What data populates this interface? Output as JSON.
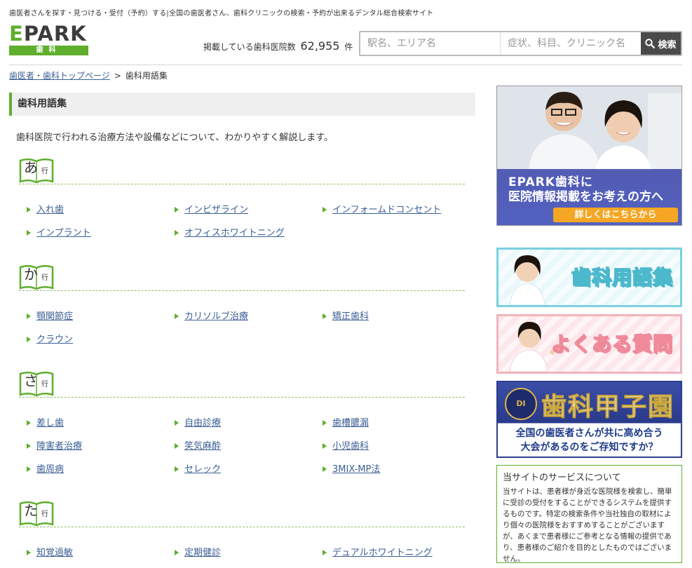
{
  "header": {
    "tagline": "歯医者さんを探す・見つける・受付（予約）する|全国の歯医者さん、歯科クリニックの検索・予約が出来るデンタル総合検索サイト",
    "logo_text": "PARK",
    "logo_letter": "E",
    "logo_sub": "歯科",
    "count_prefix": "掲載している歯科医院数",
    "count_value": "62,955",
    "count_suffix": "件",
    "search_station_placeholder": "駅名、エリア名",
    "search_keyword_placeholder": "症状、科目、クリニック名",
    "search_button": "検索"
  },
  "breadcrumb": {
    "home": "歯医者・歯科トップページ",
    "separator": ">",
    "current": "歯科用語集"
  },
  "main": {
    "title": "歯科用語集",
    "intro": "歯科医院で行われる治療方法や設備などについて、わかりやすく解説します。"
  },
  "sections": [
    {
      "kana": "あ",
      "gyo": "行",
      "items": [
        "入れ歯",
        "インビザライン",
        "インフォームドコンセント",
        "インプラント",
        "オフィスホワイトニング"
      ]
    },
    {
      "kana": "か",
      "gyo": "行",
      "items": [
        "顎関節症",
        "カリソルブ治療",
        "矯正歯科",
        "クラウン"
      ]
    },
    {
      "kana": "さ",
      "gyo": "行",
      "items": [
        "差し歯",
        "自由診療",
        "歯槽膿漏",
        "障害者治療",
        "笑気麻酔",
        "小児歯科",
        "歯周病",
        "セレック",
        "3MIX-MP法"
      ]
    },
    {
      "kana": "た",
      "gyo": "行",
      "items": [
        "知覚過敏",
        "定期健診",
        "デュアルホワイトニング"
      ]
    }
  ],
  "sidebar": {
    "recruit_line1": "EPARK歯科に",
    "recruit_line2": "医院情報掲載をお考えの方へ",
    "recruit_cta": "詳しくはこちらから",
    "glossary_banner": "歯科用語集",
    "faq_banner": "よくある質問",
    "koshien_emblem": "DI",
    "koshien_title": "歯科甲子園",
    "koshien_line1": "全国の歯医者さんが共に高め合う",
    "koshien_line2": "大会があるのをご存知ですか？",
    "about_title": "当サイトのサービスについて",
    "about_text": "当サイトは、患者様が身近な医院様を検索し、簡単に受診の受付をすることができるシステムを提供するものです。特定の検索条件や当社独自の取材により個々の医院様をおすすめすることがございますが、あくまで患者様にご参考となる情報の提供であり、患者様のご紹介を目的としたものではございません。"
  },
  "colors": {
    "brand_green": "#5fae2d",
    "link_blue": "#3b5f95",
    "search_button_bg": "#4a4a4a"
  }
}
